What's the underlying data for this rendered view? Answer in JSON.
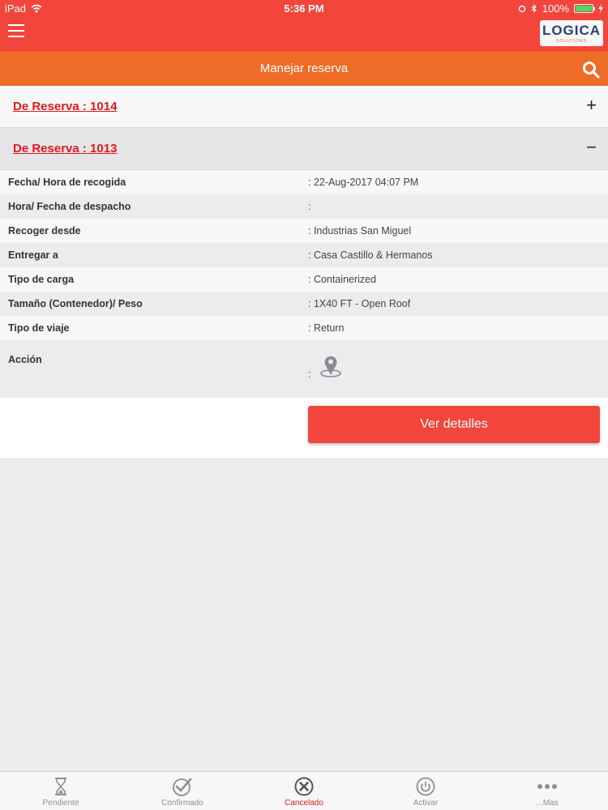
{
  "status_bar": {
    "device": "iPad",
    "time": "5:36 PM",
    "battery": "100%"
  },
  "app_bar": {
    "logo_text": "LOGICA",
    "logo_subtext": "SOLUTIONS"
  },
  "sub_header": {
    "title": "Manejar reserva"
  },
  "reservations": [
    {
      "title": "De Reserva : 1014",
      "toggle": "+"
    },
    {
      "title": "De Reserva : 1013",
      "toggle": "−"
    }
  ],
  "details": [
    {
      "label": "Fecha/ Hora de recogida",
      "value": ": 22-Aug-2017 04:07 PM"
    },
    {
      "label": "Hora/ Fecha de despacho",
      "value": ":"
    },
    {
      "label": "Recoger desde",
      "value": ": Industrias San Miguel"
    },
    {
      "label": "Entregar a",
      "value": ": Casa Castillo & Hermanos"
    },
    {
      "label": "Tipo de carga",
      "value": ": Containerized"
    },
    {
      "label": "Tamaño (Contenedor)/ Peso",
      "value": ": 1X40 FT - Open Roof"
    },
    {
      "label": "Tipo de viaje",
      "value": ": Return"
    }
  ],
  "action": {
    "label": "Acción",
    "colon": ":",
    "icon": "location-pin-icon"
  },
  "button": {
    "label": "Ver detalles"
  },
  "tabs": [
    {
      "label": "Pendiente",
      "icon": "hourglass-icon",
      "active": false
    },
    {
      "label": "Confirmado",
      "icon": "check-circle-icon",
      "active": false
    },
    {
      "label": "Cancelado",
      "icon": "x-circle-icon",
      "active": true
    },
    {
      "label": "Activar",
      "icon": "power-icon",
      "active": false
    },
    {
      "label": "...Mas",
      "icon": "more-icon",
      "active": false
    }
  ],
  "colors": {
    "primary": "#f2453b",
    "secondary": "#ee6c28",
    "link": "#e3191e"
  }
}
